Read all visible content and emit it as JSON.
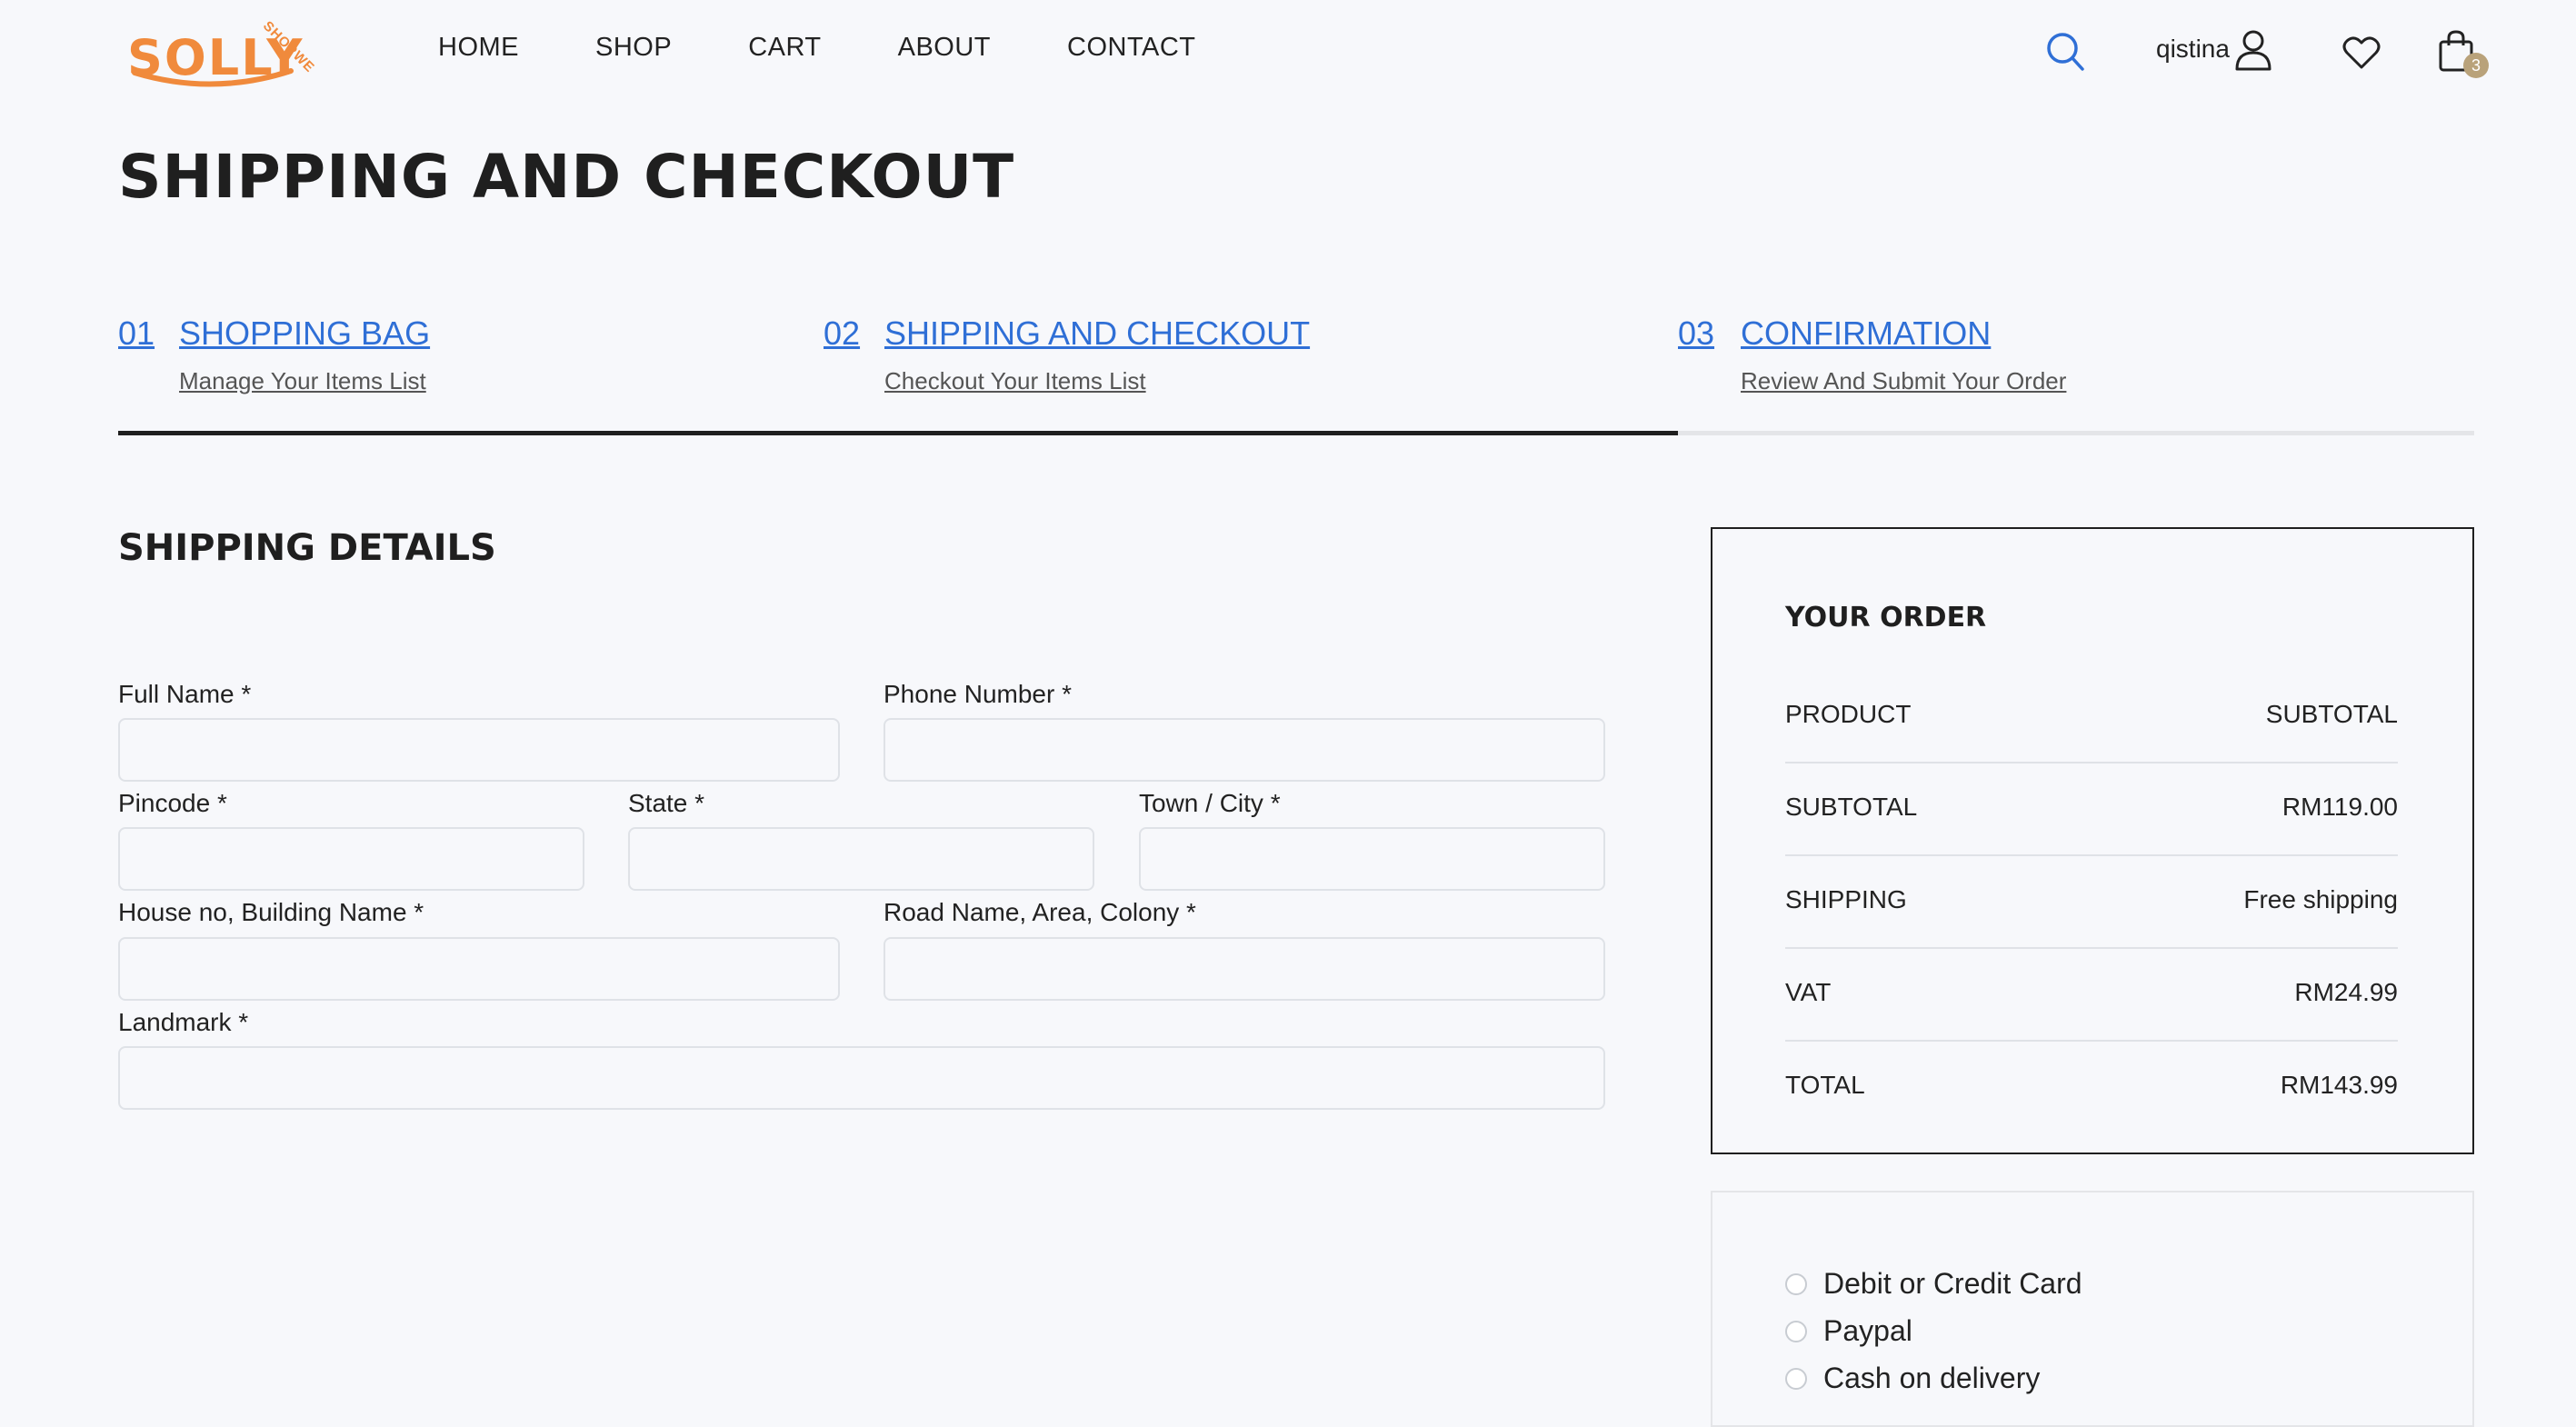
{
  "brand": {
    "logo_text": "SOLLY",
    "logo_sub": "SHOPWE",
    "accent": "#f08a3c"
  },
  "nav": {
    "items": [
      "HOME",
      "SHOP",
      "CART",
      "ABOUT",
      "CONTACT"
    ]
  },
  "header": {
    "user_name": "qistina",
    "cart_count": "3",
    "icons": [
      "search-icon",
      "user-icon",
      "heart-icon",
      "shopping-bag-icon"
    ]
  },
  "page": {
    "title": "SHIPPING AND CHECKOUT"
  },
  "steps": [
    {
      "num": "01",
      "label": "SHOPPING BAG",
      "sub": "Manage Your Items List"
    },
    {
      "num": "02",
      "label": "SHIPPING AND CHECKOUT",
      "sub": "Checkout Your Items List"
    },
    {
      "num": "03",
      "label": "CONFIRMATION",
      "sub": "Review And Submit Your Order"
    }
  ],
  "progress": {
    "current_step": 2,
    "total_steps": 3
  },
  "shipping": {
    "title": "SHIPPING DETAILS",
    "fields": {
      "full_name": {
        "label": "Full Name *",
        "value": ""
      },
      "phone": {
        "label": "Phone Number *",
        "value": ""
      },
      "pincode": {
        "label": "Pincode *",
        "value": ""
      },
      "state": {
        "label": "State *",
        "value": ""
      },
      "town": {
        "label": "Town / City *",
        "value": ""
      },
      "house": {
        "label": "House no, Building Name *",
        "value": ""
      },
      "road": {
        "label": "Road Name, Area, Colony *",
        "value": ""
      },
      "landmark": {
        "label": "Landmark *",
        "value": ""
      }
    }
  },
  "order": {
    "title": "YOUR ORDER",
    "rows": [
      {
        "key": "PRODUCT",
        "value": "SUBTOTAL"
      },
      {
        "key": "SUBTOTAL",
        "value": "RM119.00"
      },
      {
        "key": "SHIPPING",
        "value": "Free shipping"
      },
      {
        "key": "VAT",
        "value": "RM24.99"
      },
      {
        "key": "TOTAL",
        "value": "RM143.99"
      }
    ]
  },
  "payment": {
    "options": [
      "Debit or Credit Card",
      "Paypal",
      "Cash on delivery"
    ],
    "selected": null
  },
  "colors": {
    "link": "#2f6fd6",
    "text": "#222222",
    "background": "#f7f8fb",
    "badge": "#b9a27a"
  }
}
